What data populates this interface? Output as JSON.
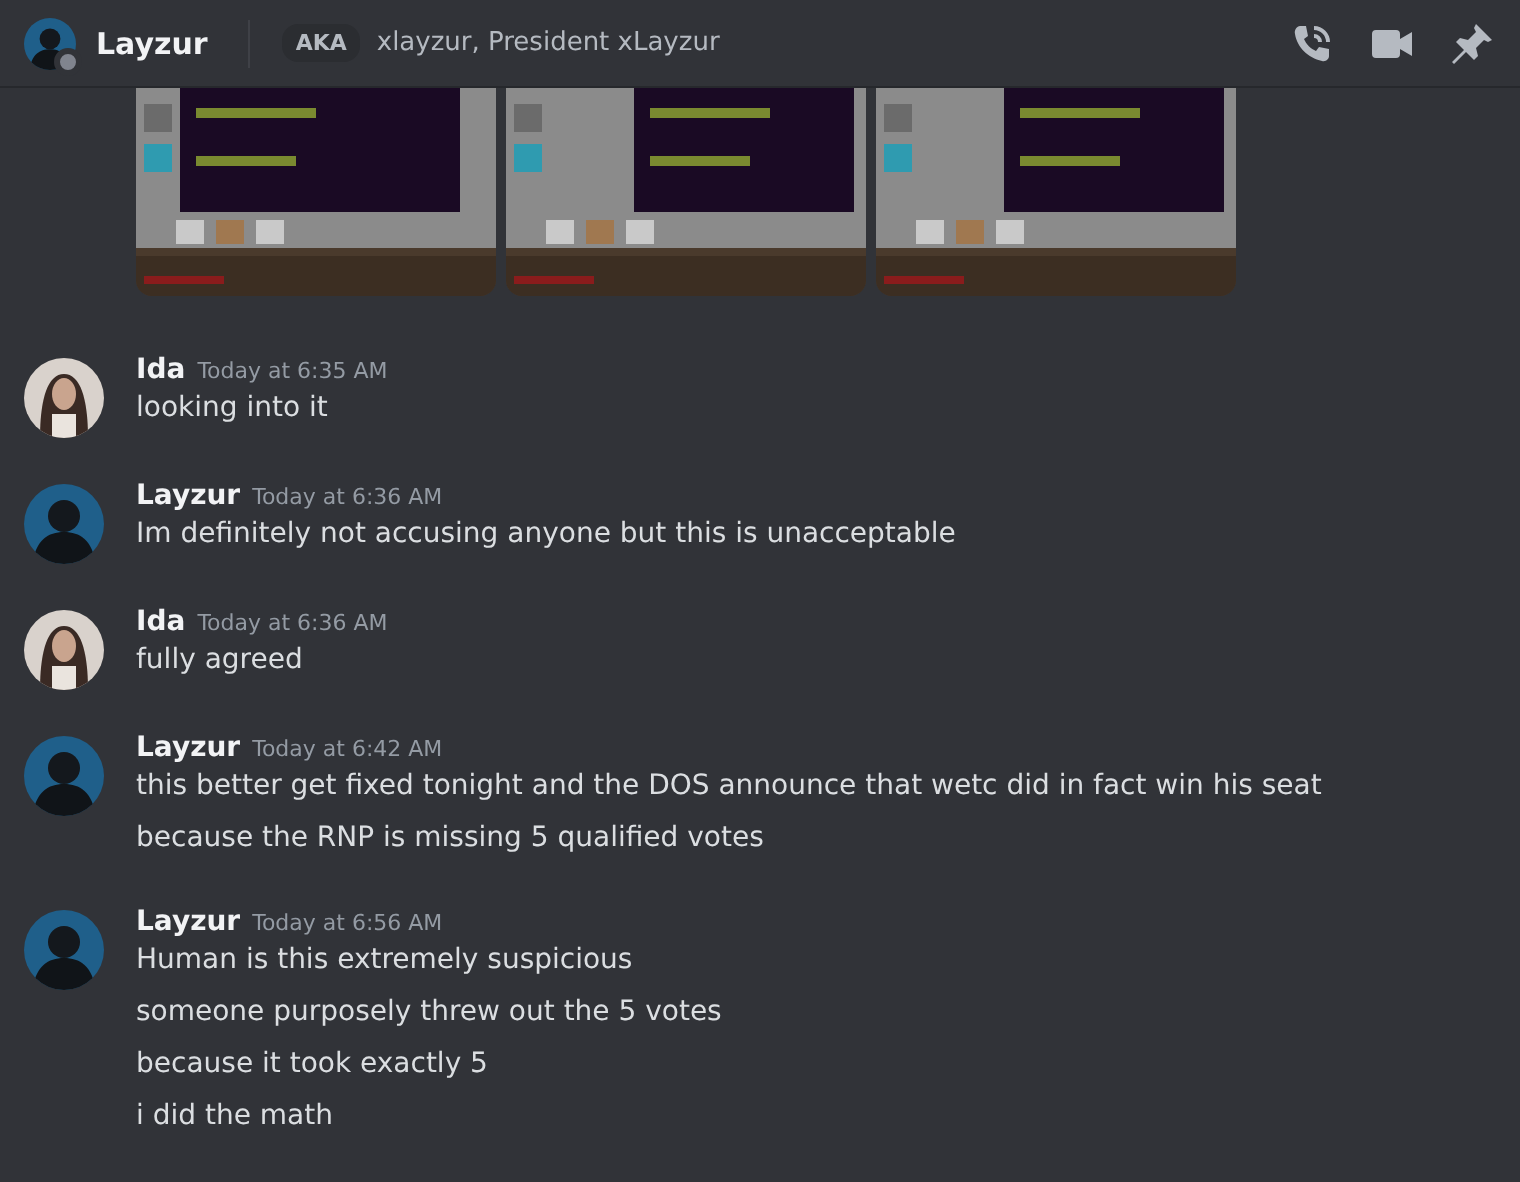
{
  "header": {
    "name": "Layzur",
    "aka_badge": "AKA",
    "aka_names": "xlayzur, President xLayzur"
  },
  "messages": [
    {
      "author": "Ida",
      "kind": "light",
      "time": "Today at 6:35 AM",
      "lines": [
        "looking into it"
      ]
    },
    {
      "author": "Layzur",
      "kind": "dark",
      "time": "Today at 6:36 AM",
      "lines": [
        "Im definitely not accusing anyone but this is unacceptable"
      ]
    },
    {
      "author": "Ida",
      "kind": "light",
      "time": "Today at 6:36 AM",
      "lines": [
        "fully agreed"
      ]
    },
    {
      "author": "Layzur",
      "kind": "dark",
      "time": "Today at 6:42 AM",
      "lines": [
        "this better get fixed tonight and the DOS announce that wetc did in fact win his seat",
        "because the RNP is missing 5 qualified votes"
      ]
    },
    {
      "author": "Layzur",
      "kind": "dark",
      "time": "Today at 6:56 AM",
      "lines": [
        "Human is this extremely suspicious",
        "someone purposely threw out the 5 votes",
        "because it took exactly 5",
        "i did the math"
      ]
    }
  ]
}
